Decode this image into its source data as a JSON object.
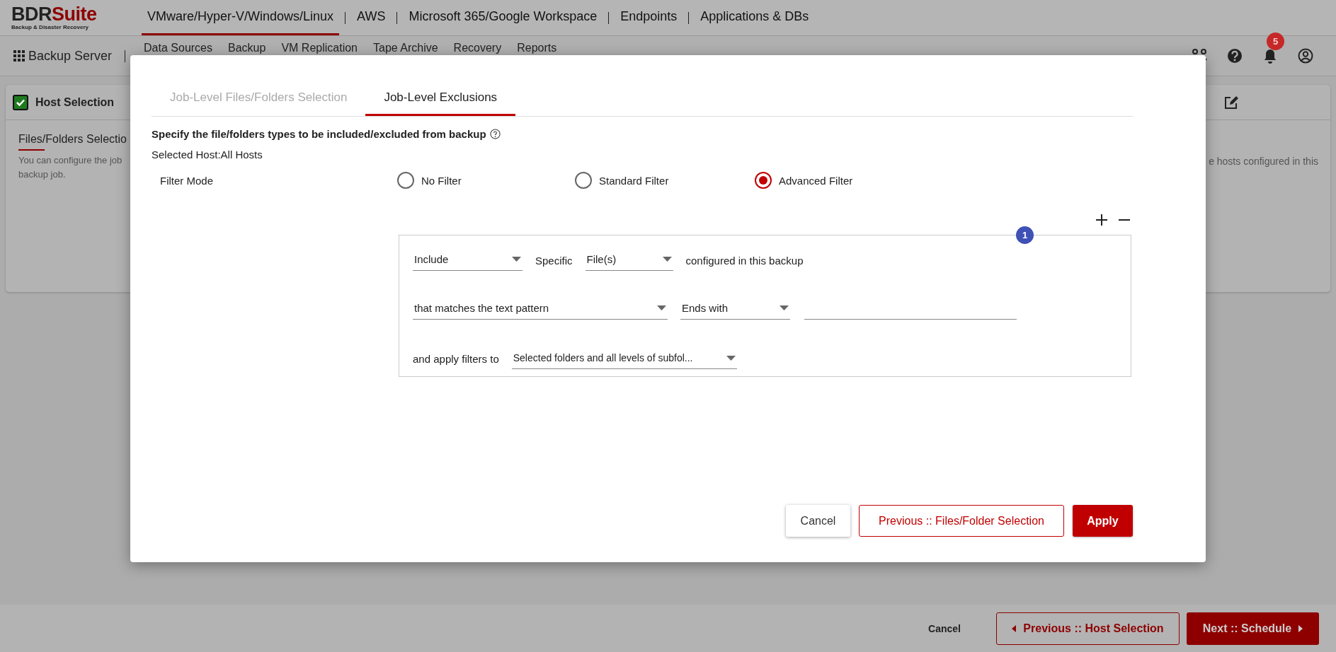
{
  "header": {
    "logo": {
      "main": "BDR",
      "accent": "Suite",
      "tagline": "Backup & Disaster Recovery"
    },
    "product_tabs": [
      {
        "label": "VMware/Hyper-V/Windows/Linux",
        "selected": true
      },
      {
        "label": "AWS",
        "selected": false
      },
      {
        "label": "Microsoft 365/Google Workspace",
        "selected": false
      },
      {
        "label": "Endpoints",
        "selected": false
      },
      {
        "label": "Applications & DBs",
        "selected": false
      }
    ]
  },
  "toolbar": {
    "title": "Backup Server",
    "menu": [
      "Data Sources",
      "Backup",
      "VM Replication",
      "Tape Archive",
      "Recovery",
      "Reports"
    ],
    "notification_count": "5"
  },
  "wizard": {
    "step": {
      "label": "Host Selection",
      "checked": true
    },
    "section_title": "Files/Folders Selectio",
    "description": "You can configure the job",
    "description_right": "e hosts configured in this",
    "description_end": "backup job."
  },
  "modal": {
    "tabs": [
      {
        "label": "Job-Level Files/Folders Selection",
        "selected": false
      },
      {
        "label": "Job-Level Exclusions",
        "selected": true
      }
    ],
    "heading": "Specify the file/folders types to be included/excluded from backup",
    "selected_host": "Selected Host:All Hosts",
    "filter_mode": {
      "label": "Filter Mode",
      "options": [
        {
          "label": "No Filter",
          "selected": false
        },
        {
          "label": "Standard Filter",
          "selected": false
        },
        {
          "label": "Advanced Filter",
          "selected": true
        }
      ]
    },
    "rule": {
      "number": "1",
      "rows": [
        [
          {
            "kind": "dropdown",
            "value": "Include"
          },
          {
            "kind": "text",
            "text": "Specific"
          },
          {
            "kind": "dropdown",
            "value": "File(s)"
          },
          {
            "kind": "text",
            "text": "configured in this backup"
          }
        ],
        [
          {
            "kind": "dropdown",
            "value": "that matches the text pattern"
          },
          {
            "kind": "dropdown",
            "value": "Ends with"
          },
          {
            "kind": "input"
          }
        ],
        [
          {
            "kind": "text",
            "text": "and apply filters to"
          },
          {
            "kind": "dropdown",
            "value": "Selected folders and all levels of subfol..."
          }
        ]
      ]
    },
    "buttons": [
      {
        "label": "Cancel",
        "kind": "plain"
      },
      {
        "label": "Previous :: Files/Folder Selection",
        "kind": "outline"
      },
      {
        "label": "Apply",
        "kind": "primary"
      }
    ]
  },
  "footer": {
    "buttons": [
      {
        "label": "Cancel",
        "kind": "text"
      },
      {
        "label": "Previous :: Host Selection",
        "kind": "previous"
      },
      {
        "label": "Next :: Schedule",
        "kind": "next"
      }
    ]
  }
}
